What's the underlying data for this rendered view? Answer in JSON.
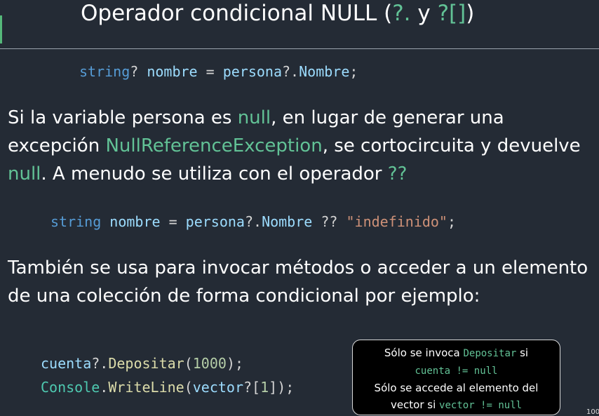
{
  "slide": {
    "title_prefix": "Operador condicional NULL (",
    "title_op1": "?.",
    "title_mid": " y ",
    "title_op2": "?[]",
    "title_suffix": ")",
    "page_number": "100"
  },
  "code1": {
    "kw": "string",
    "q": "?",
    "var": "nombre",
    "eq": " = ",
    "obj": "persona",
    "op": "?.",
    "prop": "Nombre",
    "semi": ";"
  },
  "para1": {
    "t1": "Si la variable persona es ",
    "h1": "null",
    "t2": ", en lugar de generar una excepción ",
    "h2": "NullReferenceException",
    "t3": ", se cortocircuita y devuelve ",
    "h3": "null",
    "t4": ". A menudo se utiliza con el operador ",
    "h4": "??"
  },
  "code2": {
    "kw": "string",
    "var": "nombre",
    "eq": " = ",
    "obj": "persona",
    "op": "?.",
    "prop": "Nombre",
    "coalesce": " ?? ",
    "str": "\"indefinido\"",
    "semi": ";"
  },
  "para2": {
    "text": "También se usa para invocar métodos o acceder a un elemento de una colección de forma condicional por ejemplo:"
  },
  "code3": {
    "line1": {
      "obj": "cuenta",
      "op": "?.",
      "method": "Depositar",
      "open": "(",
      "num": "1000",
      "close": ");"
    },
    "line2": {
      "cls": "Console",
      "dot": ".",
      "method": "WriteLine",
      "open": "(",
      "arr": "vector",
      "idx_open": "?[",
      "num": "1",
      "close": "]);"
    }
  },
  "tooltip": {
    "l1a": "Sólo se invoca ",
    "l1b": "Depositar",
    "l1c": " si",
    "l2": "cuenta != null",
    "l3": "Sólo se accede al elemento del",
    "l4a": "vector si ",
    "l4b": "vector != null"
  }
}
